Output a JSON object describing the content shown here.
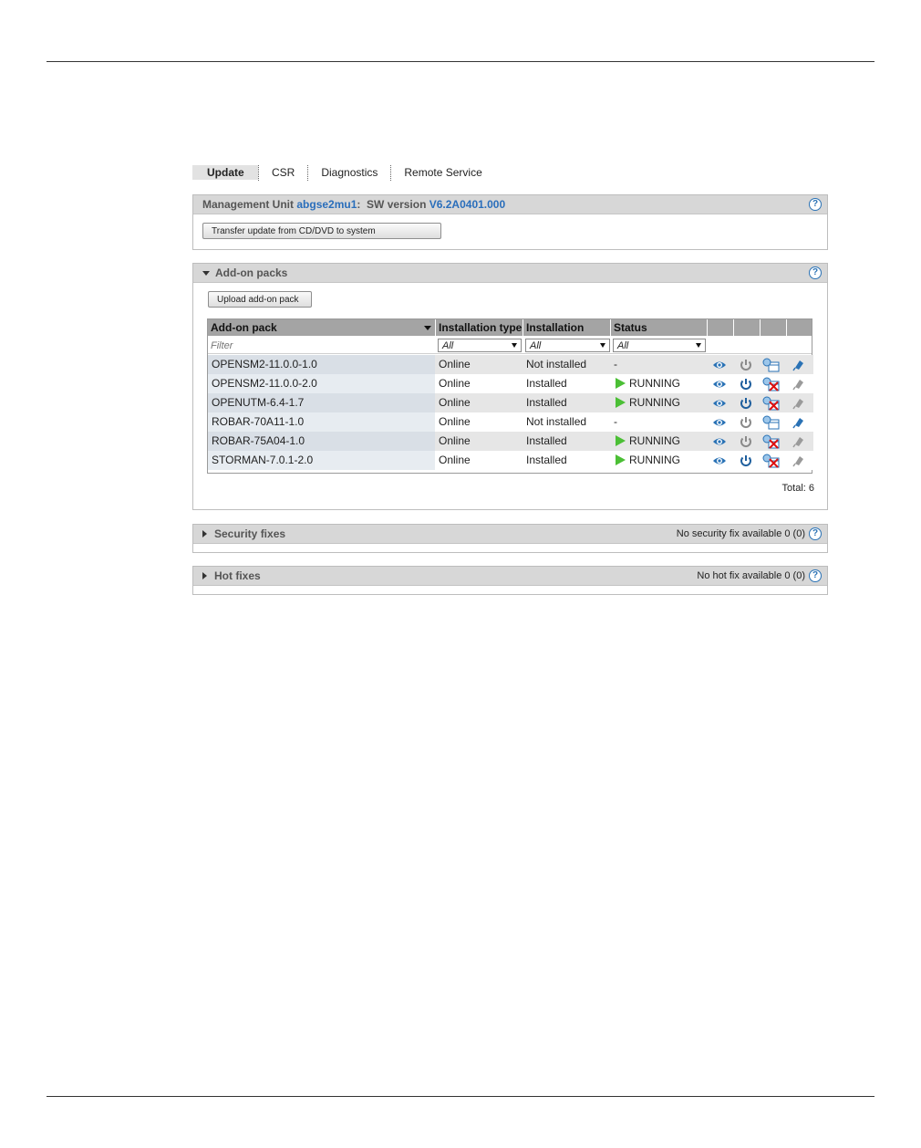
{
  "tabs": [
    {
      "label": "Update",
      "active": true
    },
    {
      "label": "CSR",
      "active": false
    },
    {
      "label": "Diagnostics",
      "active": false
    },
    {
      "label": "Remote Service",
      "active": false
    }
  ],
  "management_unit": {
    "prefix": "Management Unit",
    "unit_name": "abgse2mu1",
    "sw_label": ":  SW version",
    "sw_version": "V6.2A0401.000",
    "transfer_button": "Transfer update from CD/DVD to system"
  },
  "addon_packs": {
    "title": "Add-on packs",
    "upload_button": "Upload add-on pack",
    "columns": [
      "Add-on pack",
      "Installation type",
      "Installation",
      "Status"
    ],
    "filter_placeholder": "Filter",
    "filter_all": "All",
    "rows": [
      {
        "name": "OPENSM2-11.0.0-1.0",
        "type": "Online",
        "installation": "Not installed",
        "status": "-",
        "running": false,
        "start_enabled": false,
        "remove_enabled": false,
        "install_enabled": true
      },
      {
        "name": "OPENSM2-11.0.0-2.0",
        "type": "Online",
        "installation": "Installed",
        "status": "RUNNING",
        "running": true,
        "start_enabled": true,
        "remove_enabled": true,
        "install_enabled": false
      },
      {
        "name": "OPENUTM-6.4-1.7",
        "type": "Online",
        "installation": "Installed",
        "status": "RUNNING",
        "running": true,
        "start_enabled": true,
        "remove_enabled": true,
        "install_enabled": false
      },
      {
        "name": "ROBAR-70A11-1.0",
        "type": "Online",
        "installation": "Not installed",
        "status": "-",
        "running": false,
        "start_enabled": false,
        "remove_enabled": false,
        "install_enabled": true
      },
      {
        "name": "ROBAR-75A04-1.0",
        "type": "Online",
        "installation": "Installed",
        "status": "RUNNING",
        "running": true,
        "start_enabled": false,
        "remove_enabled": true,
        "install_enabled": false
      },
      {
        "name": "STORMAN-7.0.1-2.0",
        "type": "Online",
        "installation": "Installed",
        "status": "RUNNING",
        "running": true,
        "start_enabled": true,
        "remove_enabled": true,
        "install_enabled": false
      }
    ],
    "total": "Total: 6"
  },
  "security_fixes": {
    "title": "Security fixes",
    "info": "No security fix available 0 (0)"
  },
  "hot_fixes": {
    "title": "Hot fixes",
    "info": "No hot fix available 0 (0)"
  },
  "help_glyph": "?",
  "colors": {
    "accent": "#2a6ebb",
    "running": "#4bbf35",
    "header_gray": "#d7d7d7"
  }
}
